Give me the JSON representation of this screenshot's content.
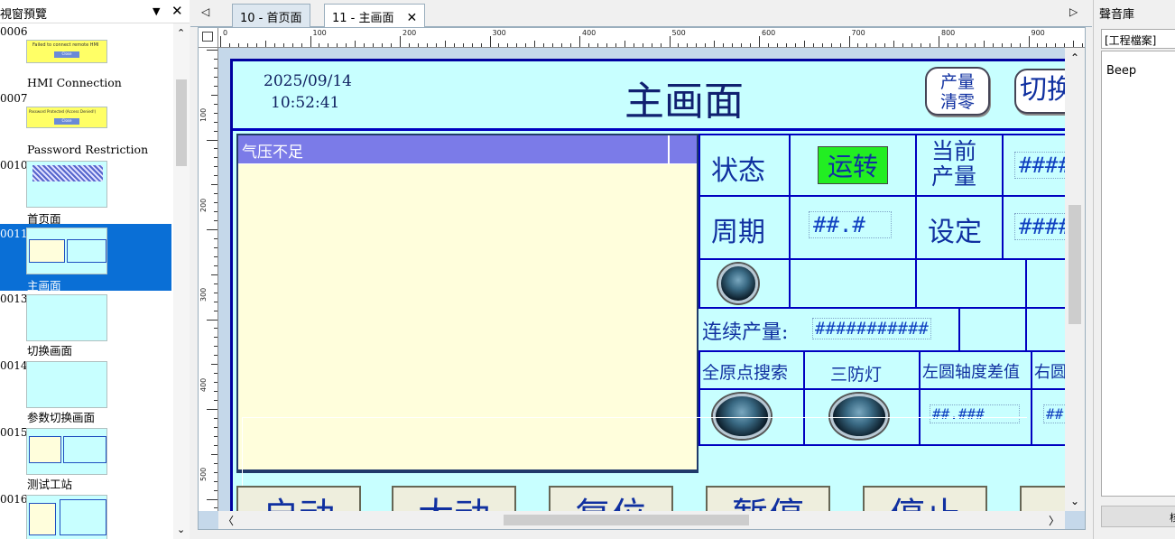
{
  "left_panel": {
    "title": "視窗預覽",
    "windows": [
      {
        "num": "0006",
        "name": ""
      },
      {
        "num": "",
        "name": "HMI Connection"
      },
      {
        "num": "0007",
        "name": ""
      },
      {
        "num": "",
        "name": "Password Restriction"
      },
      {
        "num": "0010",
        "name": ""
      },
      {
        "num": "",
        "name": "首页面"
      },
      {
        "num": "0011",
        "name": ""
      },
      {
        "num": "",
        "name": "主画面"
      },
      {
        "num": "0013",
        "name": ""
      },
      {
        "num": "",
        "name": "切换画面"
      },
      {
        "num": "0014",
        "name": ""
      },
      {
        "num": "",
        "name": "参数切换画面"
      },
      {
        "num": "0015",
        "name": ""
      },
      {
        "num": "",
        "name": "测试工站"
      },
      {
        "num": "0016",
        "name": ""
      }
    ],
    "thumb_text": {
      "t0006": "Failed to connect remote HMI",
      "t0007": "Password Protected (Access Denied!)",
      "close": "Close"
    }
  },
  "tabs": [
    {
      "label": "10 - 首页面",
      "active": false
    },
    {
      "label": "11 - 主画面",
      "active": true
    }
  ],
  "ruler": {
    "h_labels": [
      "0",
      "100",
      "200",
      "300",
      "400",
      "500",
      "600",
      "700",
      "800",
      "900"
    ],
    "v_labels": [
      "100",
      "200",
      "300",
      "400",
      "500"
    ]
  },
  "hmi": {
    "date": "2025/09/14",
    "time": "10:52:41",
    "title": "主画面",
    "clear_button": [
      "产量",
      "清零"
    ],
    "switch_button": "切换",
    "alarm_header": "气压不足",
    "status_label": "状态",
    "status_value": "运转",
    "current_output_label": [
      "当前",
      "产量"
    ],
    "current_output_value": "####",
    "cycle_label": "周期",
    "cycle_value": "##.#",
    "setting_label": "设定",
    "setting_value": "####",
    "continuous_label": "连续产量:",
    "continuous_value": "###########",
    "home_search_label": "全原点搜索",
    "tri_light_label": "三防灯",
    "left_axis_label": "左圆轴度差值",
    "right_axis_label": "右圆",
    "left_axis_value": "##.###",
    "right_axis_value": "##.",
    "bottom_buttons": [
      "启动",
      "太动",
      "复位",
      "暂停",
      "停止",
      "清"
    ]
  },
  "right_panel": {
    "title": "聲音庫",
    "tab": "[工程檔案]",
    "items": [
      "Beep"
    ],
    "button": "核"
  },
  "colors": {
    "hmi_bg": "#c8ffff",
    "hmi_border": "#0000c0",
    "run_green": "#22ee22",
    "alarm_header": "#7b7be8",
    "selection": "#0a6fd6"
  }
}
